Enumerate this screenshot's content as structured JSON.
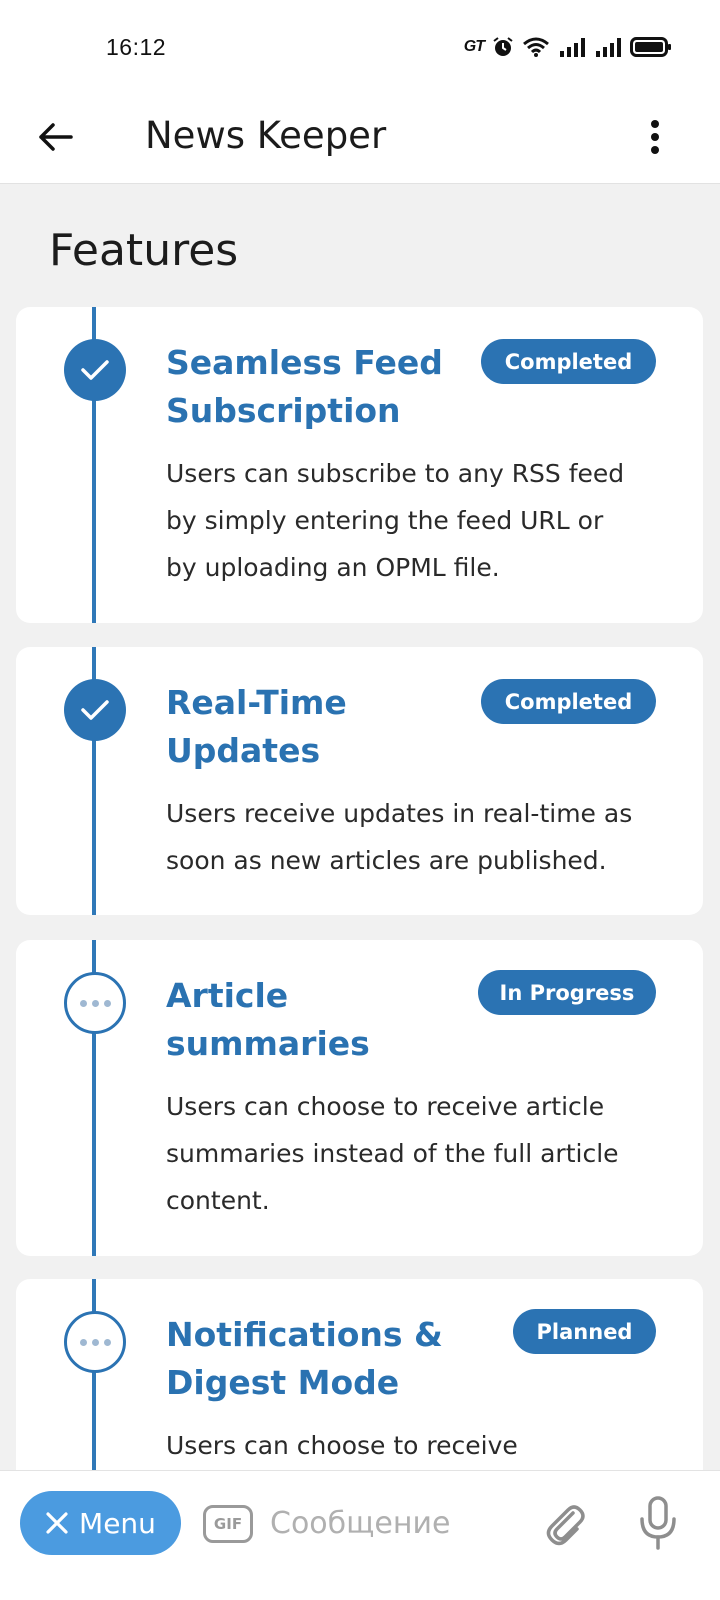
{
  "status_bar": {
    "time": "16:12",
    "carrier_icon_text": "GT"
  },
  "app_bar": {
    "title": "News Keeper"
  },
  "section": {
    "title": "Features"
  },
  "features": [
    {
      "title_lines": [
        "Seamless Feed",
        "Subscription"
      ],
      "status": "Completed",
      "state": "done",
      "description_lines": [
        "Users can subscribe to any RSS feed",
        "by simply entering the feed URL or",
        "by uploading an OPML file."
      ]
    },
    {
      "title_lines": [
        "Real-Time",
        "Updates"
      ],
      "status": "Completed",
      "state": "done",
      "description_lines": [
        "Users receive updates in real-time as",
        "soon as new articles are published."
      ]
    },
    {
      "title_lines": [
        "Article",
        "summaries"
      ],
      "status": "In Progress",
      "state": "in-progress",
      "description_lines": [
        "Users can choose to receive article",
        "summaries instead of the full article",
        "content."
      ]
    },
    {
      "title_lines": [
        "Notifications &",
        "Digest Mode"
      ],
      "status": "Planned",
      "state": "planned",
      "description_lines": [
        "Users can choose to receive"
      ]
    }
  ],
  "bottom_bar": {
    "menu_label": "Menu",
    "gif_label": "GIF",
    "message_placeholder": "Сообщение"
  },
  "colors": {
    "accent": "#2b73b3",
    "menu": "#4b9be0",
    "background": "#f1f1f1"
  },
  "icons": [
    "back-arrow-icon",
    "more-vert-icon",
    "check-icon",
    "dots-icon",
    "close-icon",
    "gif-icon",
    "paperclip-icon",
    "microphone-icon",
    "alarm-icon",
    "wifi-icon",
    "signal-icon",
    "battery-icon"
  ]
}
